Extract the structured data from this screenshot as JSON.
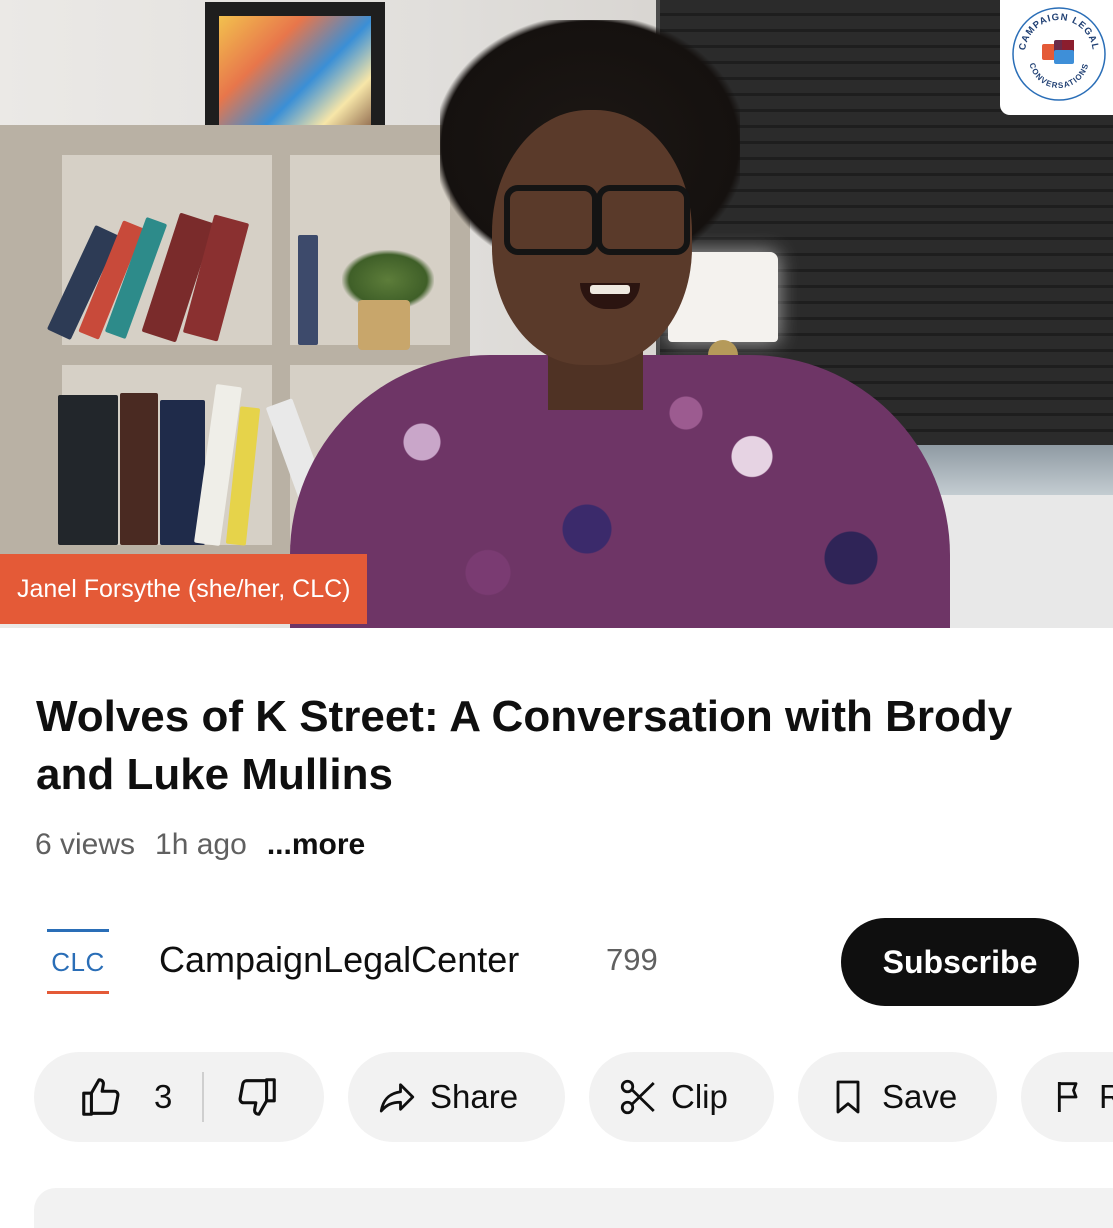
{
  "video": {
    "speaker_label": "Janel Forsythe (she/her, CLC)",
    "watermark_name": "campaign-legal-conversations-logo",
    "watermark_text_top": "CAMPAIGN LEGAL",
    "watermark_text_bottom": "CONVERSATIONS"
  },
  "info": {
    "title": "Wolves of K Street: A Conversation with Brody and Luke Mullins",
    "views": "6 views",
    "age": "1h ago",
    "more": "...more"
  },
  "channel": {
    "logo_text": "CLC",
    "name": "CampaignLegalCenter",
    "subscribers": "799",
    "subscribe_label": "Subscribe"
  },
  "actions": {
    "like_count": "3",
    "share_label": "Share",
    "clip_label": "Clip",
    "save_label": "Save",
    "report_label": "R"
  },
  "colors": {
    "accent_orange": "#e45a37",
    "clc_blue": "#2a6eb7",
    "subscribe_bg": "#0f0f0f",
    "pill_bg": "#f2f2f2"
  }
}
